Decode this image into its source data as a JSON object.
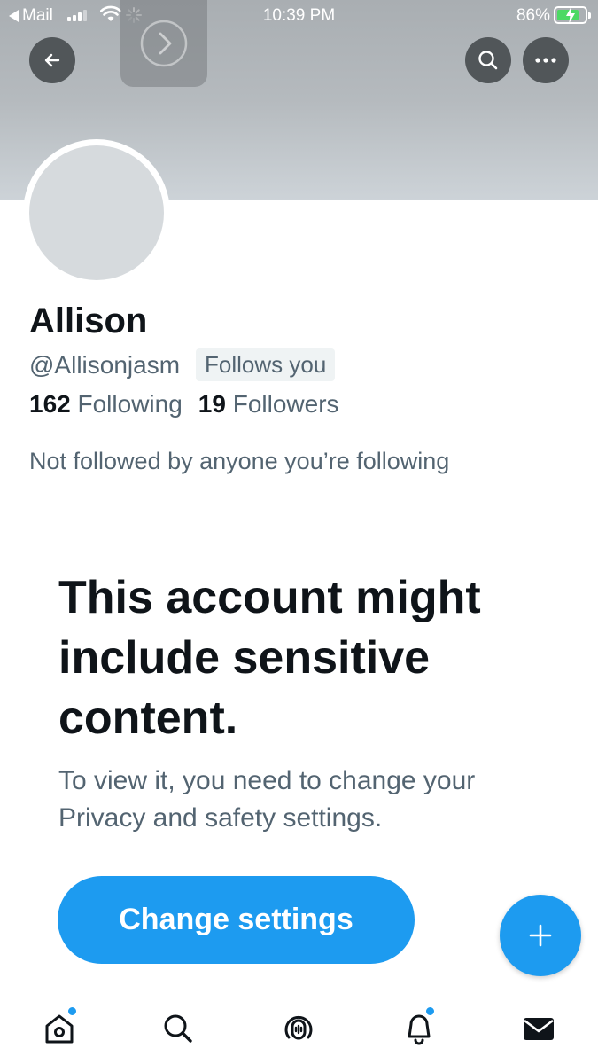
{
  "status_bar": {
    "back_app": "Mail",
    "time": "10:39 PM",
    "battery_percent": "86%",
    "battery_level": 0.86
  },
  "header": {
    "icons": [
      "back-arrow-icon",
      "forward-chevron-icon",
      "search-icon",
      "more-icon"
    ]
  },
  "profile": {
    "name": "Allison",
    "handle": "@Allisonjasm",
    "follows_you": "Follows you",
    "following_count": "162",
    "following_label": "Following",
    "followers_count": "19",
    "followers_label": "Followers",
    "mutual_text": "Not followed by anyone you’re following"
  },
  "sensitive_notice": {
    "title": "This account might include sensitive content.",
    "description": "To view it, you need to change your Privacy and safety settings.",
    "button_label": "Change settings"
  },
  "tabbar": {
    "items": [
      "home-icon",
      "search-icon",
      "spaces-icon",
      "notifications-icon",
      "messages-icon"
    ]
  },
  "colors": {
    "accent": "#1d9bf0",
    "text_primary": "#0f1419",
    "text_secondary": "#536471",
    "battery_green": "#4cd964"
  }
}
